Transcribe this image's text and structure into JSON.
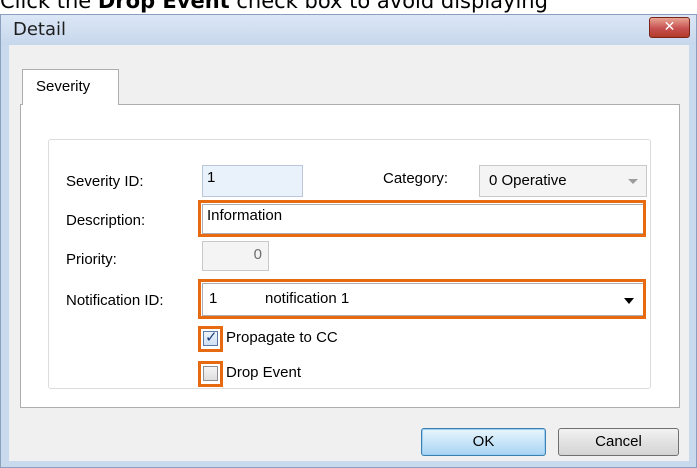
{
  "caption": {
    "prefix": "Click the ",
    "bold": "Drop Event",
    "suffix": " check box to avoid displaying"
  },
  "window": {
    "title": "Detail",
    "close_label": "✕"
  },
  "tabs": [
    {
      "label": "Severity"
    }
  ],
  "form": {
    "severity_id": {
      "label": "Severity ID:",
      "value": "1"
    },
    "category": {
      "label": "Category:",
      "value": "0 Operative"
    },
    "description": {
      "label": "Description:",
      "value": "Information"
    },
    "priority": {
      "label": "Priority:",
      "value": "0"
    },
    "notification_id": {
      "label": "Notification ID:",
      "value_id": "1",
      "value_name": "notification 1"
    },
    "propagate_to_cc": {
      "label": "Propagate to CC",
      "checked": true
    },
    "drop_event": {
      "label": "Drop Event",
      "checked": false
    }
  },
  "buttons": {
    "ok": "OK",
    "cancel": "Cancel"
  },
  "colors": {
    "highlight": "#e86a10",
    "window_frame": "#c9d9ee",
    "close_button": "#c75050"
  },
  "icons": {
    "checkmark": "check-icon",
    "dropdown": "chevron-down-icon",
    "close": "close-icon"
  }
}
